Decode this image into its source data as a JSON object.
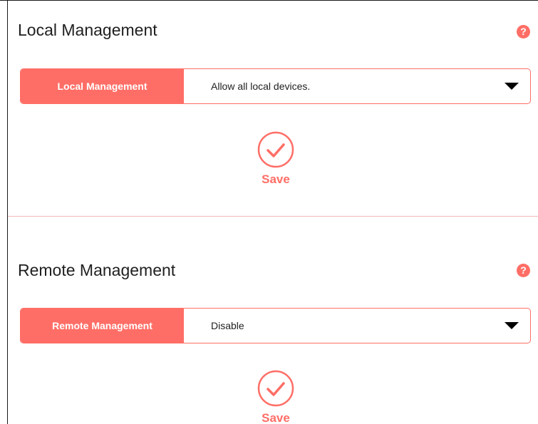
{
  "colors": {
    "accent": "#ff6e66",
    "text": "#1f1f1f",
    "divider": "#f2b8b8"
  },
  "local": {
    "title": "Local Management",
    "help_icon": "?",
    "field_label": "Local Management",
    "selected_value": "Allow all local devices.",
    "save_label": "Save"
  },
  "remote": {
    "title": "Remote Management",
    "help_icon": "?",
    "field_label": "Remote Management",
    "selected_value": "Disable",
    "save_label": "Save"
  }
}
